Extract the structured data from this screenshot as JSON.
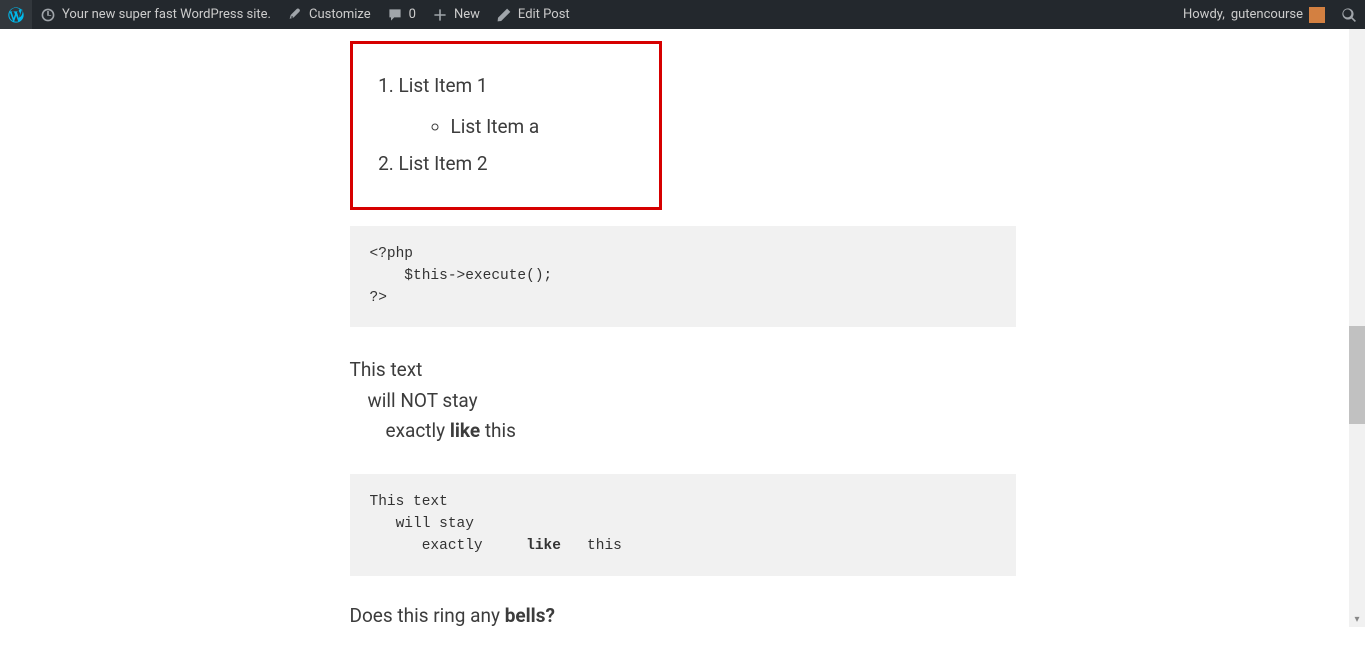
{
  "admin": {
    "site_title": "Your new super fast WordPress site.",
    "customize": "Customize",
    "comment_count": "0",
    "new": "New",
    "edit_post": "Edit Post",
    "howdy_prefix": "Howdy, ",
    "user": "gutencourse"
  },
  "list": {
    "item1": "List Item 1",
    "item1a": "List Item a",
    "item2": "List Item 2"
  },
  "code1": "<?php\n    $this->execute();\n?>",
  "para_not_stay": {
    "line1": "This text",
    "line2": "will NOT stay",
    "line3_a": "exactly    ",
    "line3_b": "like",
    "line3_c": " this"
  },
  "pre_stay": "This text\n   will stay\n      exactly     like   this",
  "pre_stay_plain_before": "This text\n   will stay\n      exactly     ",
  "pre_stay_bold": "like",
  "pre_stay_plain_after": "   this",
  "final": {
    "before": "Does this ring any ",
    "bold": "bells?"
  }
}
